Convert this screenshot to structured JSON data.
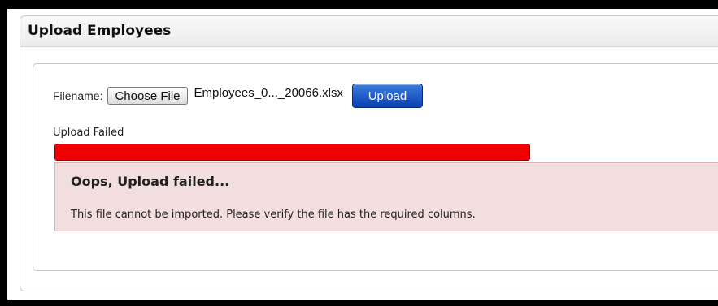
{
  "panel": {
    "title": "Upload Employees"
  },
  "upload_form": {
    "filename_label": "Filename:",
    "choose_file_label": "Choose File",
    "selected_file": "Employees_0..._20066.xlsx",
    "upload_label": "Upload"
  },
  "status": {
    "label": "Upload Failed",
    "progress_fraction": 1.0,
    "bar_color": "#f00000"
  },
  "alert": {
    "title": "Oops, Upload failed...",
    "message": "This file cannot be imported. Please verify the file has the required columns.",
    "background": "#f2dede"
  }
}
